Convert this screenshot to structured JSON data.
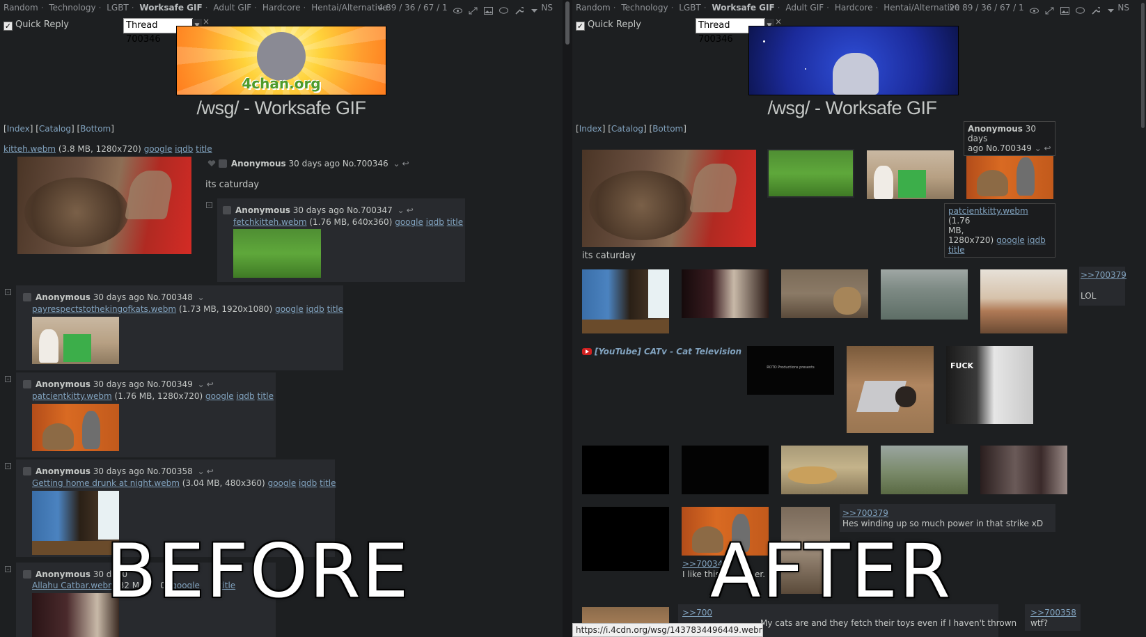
{
  "nav": {
    "boards": [
      "Random",
      "Technology",
      "LGBT",
      "Worksafe GIF",
      "Adult GIF",
      "Hardcore",
      "Hentai/Alternative"
    ],
    "current_board": "Worksafe GIF",
    "stats_left": "4 89 / 36 / 67 / 1",
    "stats_right": "20 89 / 36 / 67 / 1",
    "ns_label": "NS"
  },
  "quick_reply": {
    "label": "Quick Reply",
    "thread_label": "Thread 700346",
    "close": "×"
  },
  "banner": {
    "left_text": "4chan.org"
  },
  "board_title": "/wsg/ - Worksafe GIF",
  "navlinks": {
    "index": "Index",
    "catalog": "Catalog",
    "bottom": "Bottom"
  },
  "op": {
    "filename": "kitteh.webm",
    "meta": "(3.8 MB, 1280x720)",
    "google": "google",
    "iqdb": "iqdb",
    "title": "title",
    "name": "Anonymous",
    "time": "30 days ago",
    "no": "No.700346",
    "text": "its caturday"
  },
  "replies": [
    {
      "name": "Anonymous",
      "time": "30 days ago",
      "no": "No.700347",
      "filename": "fetchkitteh.webm",
      "meta": "(1.76 MB, 640x360)"
    },
    {
      "name": "Anonymous",
      "time": "30 days ago",
      "no": "No.700348",
      "filename": "payrespectstothekingofkats.webm",
      "meta": "(1.73 MB, 1920x1080)"
    },
    {
      "name": "Anonymous",
      "time": "30 days ago",
      "no": "No.700349",
      "filename": "patcientkitty.webm",
      "meta": "(1.76 MB, 1280x720)"
    },
    {
      "name": "Anonymous",
      "time": "30 days ago",
      "no": "No.700358",
      "filename": "Getting home drunk at night.webm",
      "meta": "(3.04 MB, 480x360)"
    },
    {
      "name": "Anonymous",
      "time": "30 da",
      "no": "70",
      "filename": "Allahu Catbar.webm",
      "meta": "32 M",
      "partial_meta": "0)"
    }
  ],
  "right": {
    "tooltip_header": "Anonymous",
    "tooltip_time": "30 days",
    "tooltip_no": "ago No.700349",
    "tooltip_filename": "patcientkitty.webm",
    "tooltip_meta_1": "(1.76",
    "tooltip_meta_2": "MB,",
    "tooltip_meta_3": "1280x720)",
    "caption": "its caturday",
    "q1_link": ">>700379",
    "q1_text": "LOL",
    "youtube": "[YouTube] CATv - Cat Television",
    "video_card_text": "ROTO Productions presents",
    "q2_link": ">>700379",
    "q2_text": "Hes winding up so much power in that strike xD",
    "q3_link": ">>700349",
    "q3_text": "I like this",
    "q3_text_b": "er.",
    "q4_link": ">>700",
    "q4_text": "My cats are and they fetch their toys even if I haven't thrown",
    "q5_link": ">>700358",
    "q5_text": "wtf?",
    "fuck_text": "FUCK"
  },
  "status_url": "https://i.4cdn.org/wsg/1437834496449.webm",
  "overlay": {
    "before": "BEFORE",
    "after": "AFTER"
  },
  "colors": {
    "bg": "#1d1f21",
    "post_bg": "#282a2e",
    "link": "#81a2be",
    "text": "#c5c8c6"
  }
}
